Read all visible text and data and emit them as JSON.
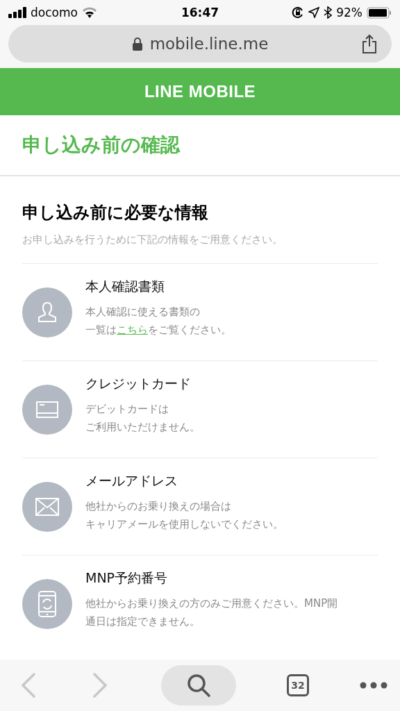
{
  "status_bar": {
    "carrier": "docomo",
    "time": "16:47",
    "battery": "92%"
  },
  "address_bar": {
    "url": "mobile.line.me"
  },
  "header": {
    "logo": "LINE MOBILE"
  },
  "page_title": "申し込み前の確認",
  "section": {
    "title": "申し込み前に必要な情報",
    "subtitle": "お申し込みを行うために下記の情報をご用意ください。"
  },
  "items": [
    {
      "kind": "person",
      "title": "本人確認書類",
      "description": [
        [
          {
            "text": "本人確認に使える書類の",
            "link": false
          }
        ],
        [
          {
            "text": "一覧は",
            "link": false
          },
          {
            "text": "こちら",
            "link": true
          },
          {
            "text": "をご覧ください。",
            "link": false
          }
        ]
      ]
    },
    {
      "kind": "card",
      "title": "クレジットカード",
      "description": [
        [
          {
            "text": "デビットカードは",
            "link": false
          }
        ],
        [
          {
            "text": "ご利用いただけません。",
            "link": false
          }
        ]
      ]
    },
    {
      "kind": "mail",
      "title": "メールアドレス",
      "description": [
        [
          {
            "text": "他社からのお乗り換えの場合は",
            "link": false
          }
        ],
        [
          {
            "text": "キャリアメールを使用しないでください。",
            "link": false
          }
        ]
      ]
    },
    {
      "kind": "phone",
      "title": "MNP予約番号",
      "description": [
        [
          {
            "text": "他社からお乗り換えの方のみご用意ください。MNP開",
            "link": false
          }
        ],
        [
          {
            "text": "通日は指定できません。",
            "link": false
          }
        ]
      ]
    }
  ],
  "toolbar": {
    "back_disabled": true,
    "forward_disabled": true,
    "tab_count": "32"
  }
}
